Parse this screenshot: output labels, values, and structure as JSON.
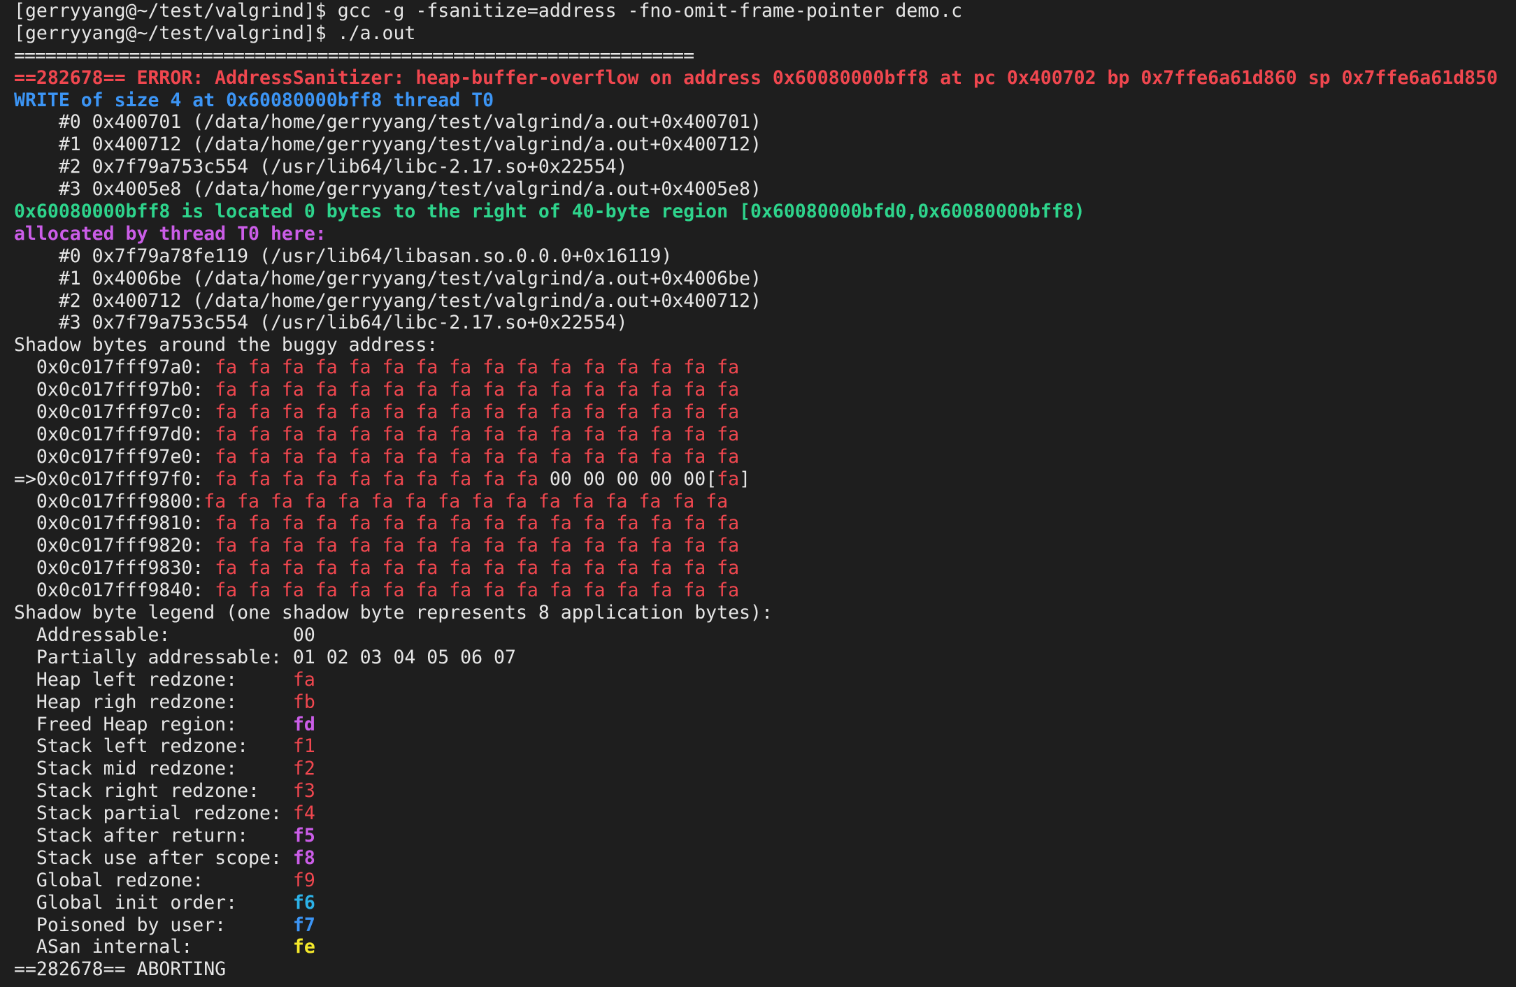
{
  "colors": {
    "background": "#1e1e1e",
    "text": "#e6e6e6",
    "error_red": "#f0474f",
    "access_blue": "#3c95f5",
    "location_green": "#2ed48c",
    "alloc_magenta": "#cb5de8",
    "cyan": "#2cb2e8",
    "yellow": "#f5e92b"
  },
  "commands": {
    "prompt": "[gerryyang@~/test/valgrind]$ ",
    "cmd1": "gcc -g -fsanitize=address -fno-omit-frame-pointer demo.c",
    "cmd2": "./a.out"
  },
  "separator": "=================================================================",
  "error_line": "==282678== ERROR: AddressSanitizer: heap-buffer-overflow on address 0x60080000bff8 at pc 0x400702 bp 0x7ffe6a61d860 sp 0x7ffe6a61d850",
  "write_line": "WRITE of size 4 at 0x60080000bff8 thread T0",
  "write_frames": [
    "    #0 0x400701 (/data/home/gerryyang/test/valgrind/a.out+0x400701)",
    "    #1 0x400712 (/data/home/gerryyang/test/valgrind/a.out+0x400712)",
    "    #2 0x7f79a753c554 (/usr/lib64/libc-2.17.so+0x22554)",
    "    #3 0x4005e8 (/data/home/gerryyang/test/valgrind/a.out+0x4005e8)"
  ],
  "location_line": "0x60080000bff8 is located 0 bytes to the right of 40-byte region [0x60080000bfd0,0x60080000bff8)",
  "allocated_line": "allocated by thread T0 here:",
  "alloc_frames": [
    "    #0 0x7f79a78fe119 (/usr/lib64/libasan.so.0.0.0+0x16119)",
    "    #1 0x4006be (/data/home/gerryyang/test/valgrind/a.out+0x4006be)",
    "    #2 0x400712 (/data/home/gerryyang/test/valgrind/a.out+0x400712)",
    "    #3 0x7f79a753c554 (/usr/lib64/libc-2.17.so+0x22554)"
  ],
  "shadow_header": "Shadow bytes around the buggy address:",
  "shadow_rows": [
    {
      "addr": "  0x0c017fff97a0: ",
      "bytes": "fa fa fa fa fa fa fa fa fa fa fa fa fa fa fa fa"
    },
    {
      "addr": "  0x0c017fff97b0: ",
      "bytes": "fa fa fa fa fa fa fa fa fa fa fa fa fa fa fa fa"
    },
    {
      "addr": "  0x0c017fff97c0: ",
      "bytes": "fa fa fa fa fa fa fa fa fa fa fa fa fa fa fa fa"
    },
    {
      "addr": "  0x0c017fff97d0: ",
      "bytes": "fa fa fa fa fa fa fa fa fa fa fa fa fa fa fa fa"
    },
    {
      "addr": "  0x0c017fff97e0: ",
      "bytes": "fa fa fa fa fa fa fa fa fa fa fa fa fa fa fa fa"
    }
  ],
  "buggy_row": {
    "addr": "=>0x0c017fff97f0: ",
    "red_part": "fa fa fa fa fa fa fa fa fa fa ",
    "white_part": "00 00 00 00 00",
    "bracket_open": "[",
    "bracket_val": "fa",
    "bracket_close": "]"
  },
  "row_9800": {
    "addr": "  0x0c017fff9800:",
    "bytes": "fa fa fa fa fa fa fa fa fa fa fa fa fa fa fa fa"
  },
  "shadow_rows_after": [
    {
      "addr": "  0x0c017fff9810: ",
      "bytes": "fa fa fa fa fa fa fa fa fa fa fa fa fa fa fa fa"
    },
    {
      "addr": "  0x0c017fff9820: ",
      "bytes": "fa fa fa fa fa fa fa fa fa fa fa fa fa fa fa fa"
    },
    {
      "addr": "  0x0c017fff9830: ",
      "bytes": "fa fa fa fa fa fa fa fa fa fa fa fa fa fa fa fa"
    },
    {
      "addr": "  0x0c017fff9840: ",
      "bytes": "fa fa fa fa fa fa fa fa fa fa fa fa fa fa fa fa"
    }
  ],
  "legend_header": "Shadow byte legend (one shadow byte represents 8 application bytes):",
  "legend": [
    {
      "label": "  Addressable:           ",
      "value": "00",
      "color": "white",
      "bold": false
    },
    {
      "label": "  Partially addressable: ",
      "value": "01 02 03 04 05 06 07",
      "color": "white",
      "bold": false
    },
    {
      "label": "  Heap left redzone:     ",
      "value": "fa",
      "color": "red",
      "bold": false
    },
    {
      "label": "  Heap righ redzone:     ",
      "value": "fb",
      "color": "red",
      "bold": false
    },
    {
      "label": "  Freed Heap region:     ",
      "value": "fd",
      "color": "magenta",
      "bold": true
    },
    {
      "label": "  Stack left redzone:    ",
      "value": "f1",
      "color": "red",
      "bold": false
    },
    {
      "label": "  Stack mid redzone:     ",
      "value": "f2",
      "color": "red",
      "bold": false
    },
    {
      "label": "  Stack right redzone:   ",
      "value": "f3",
      "color": "red",
      "bold": false
    },
    {
      "label": "  Stack partial redzone: ",
      "value": "f4",
      "color": "red",
      "bold": false
    },
    {
      "label": "  Stack after return:    ",
      "value": "f5",
      "color": "magenta",
      "bold": true
    },
    {
      "label": "  Stack use after scope: ",
      "value": "f8",
      "color": "magenta",
      "bold": true
    },
    {
      "label": "  Global redzone:        ",
      "value": "f9",
      "color": "red",
      "bold": false
    },
    {
      "label": "  Global init order:     ",
      "value": "f6",
      "color": "cyan",
      "bold": true
    },
    {
      "label": "  Poisoned by user:      ",
      "value": "f7",
      "color": "blue",
      "bold": true
    },
    {
      "label": "  ASan internal:         ",
      "value": "fe",
      "color": "yellow",
      "bold": true
    }
  ],
  "aborting_line": "==282678== ABORTING"
}
